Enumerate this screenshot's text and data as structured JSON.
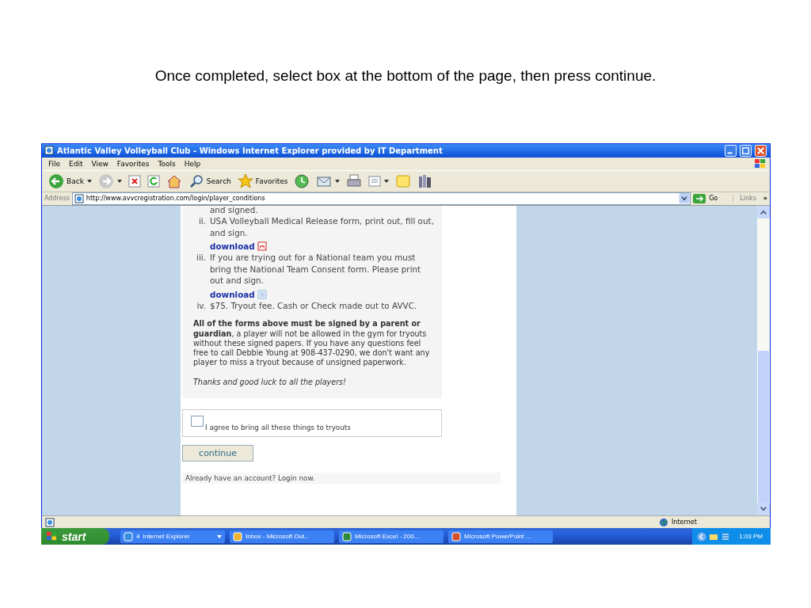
{
  "slide_caption": "Once completed, select box at the bottom of the page, then press continue.",
  "window": {
    "title": "Atlantic Valley Volleyball Club - Windows Internet Explorer provided by IT Department",
    "menu": [
      "File",
      "Edit",
      "View",
      "Favorites",
      "Tools",
      "Help"
    ],
    "toolbar": [
      {
        "kind": "back",
        "label": "Back",
        "caret": true
      },
      {
        "kind": "forward",
        "caret": true
      },
      {
        "kind": "stop"
      },
      {
        "kind": "refresh"
      },
      {
        "kind": "home"
      },
      {
        "kind": "search",
        "label": "Search"
      },
      {
        "kind": "favorites",
        "label": "Favorites"
      },
      {
        "kind": "history"
      },
      {
        "kind": "mail",
        "caret": true
      },
      {
        "kind": "print"
      },
      {
        "kind": "edit",
        "caret": true
      },
      {
        "kind": "note"
      },
      {
        "kind": "research"
      }
    ],
    "address": {
      "label": "Address",
      "url": "http://www.avvcregistration.com/login/player_conditions",
      "go": "Go",
      "links": "Links",
      "more": "»"
    }
  },
  "page": {
    "items": [
      {
        "text": "and signed."
      },
      {
        "numeral": "ii.",
        "text": "USA Volleyball Medical Release form, print out, fill out, and sign.",
        "download": {
          "label": "download",
          "kind": "pdf"
        }
      },
      {
        "numeral": "iii.",
        "text": "If you are trying out for a National team you must bring the National Team Consent form. Please print out and sign.",
        "download": {
          "label": "download",
          "kind": "doc"
        }
      },
      {
        "numeral": "iv.",
        "text": "$75. Tryout fee. Cash or Check made out to AVVC."
      }
    ],
    "notice": "**All of the forms above must be signed by a parent or guardian**, a player will not be allowed in the gym for tryouts without these signed papers. If you have any questions feel free to call Debbie Young at 908-437-0290, we don't want any player to miss a tryout because of unsigned paperwork.",
    "thanks": "Thanks and good luck to all the players!",
    "agree": {
      "label": "I agree to bring all these things to tryouts",
      "checked": false
    },
    "continue": "continue",
    "account": "Already have an account? Login now."
  },
  "status_bar": {
    "zone": "Internet"
  },
  "taskbar": {
    "start": "start",
    "tasks": [
      {
        "kind": "ie",
        "count": "4",
        "label": "Internet Explorer"
      },
      {
        "kind": "outlook",
        "label": "Inbox - Microsoft Out..."
      },
      {
        "kind": "excel",
        "label": "Microsoft Excel - 200..."
      },
      {
        "kind": "powerpoint",
        "label": "Microsoft PowerPoint ..."
      }
    ],
    "clock": "1:03 PM"
  }
}
